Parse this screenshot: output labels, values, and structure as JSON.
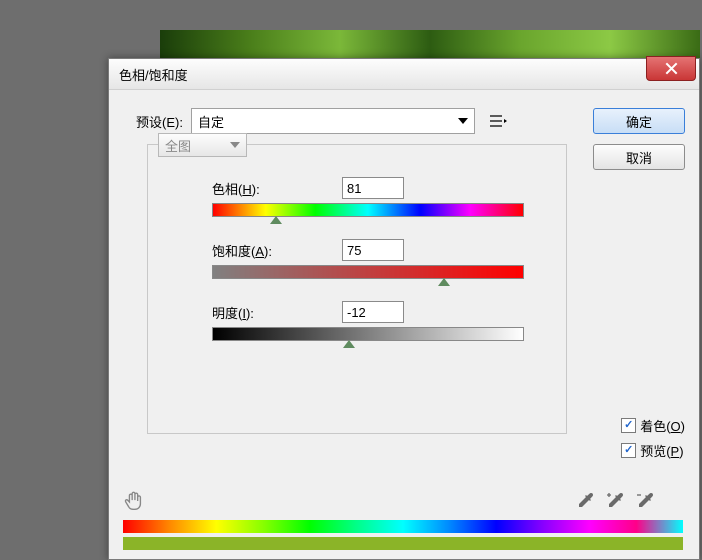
{
  "dialog": {
    "title": "色相/饱和度",
    "preset_label": "预设(E):",
    "preset_value": "自定",
    "range_value": "全图",
    "params": {
      "hue_label": "色相(",
      "hue_hotkey": "H",
      "hue_label_end": "):",
      "hue_value": "81",
      "sat_label": "饱和度(",
      "sat_hotkey": "A",
      "sat_label_end": "):",
      "sat_value": "75",
      "light_label": "明度(",
      "light_hotkey": "I",
      "light_label_end": "):",
      "light_value": "-12"
    },
    "colorize_label": "着色(",
    "colorize_hotkey": "O",
    "colorize_label_end": ")",
    "preview_label": "预览(",
    "preview_hotkey": "P",
    "preview_label_end": ")",
    "ok_label": "确定",
    "cancel_label": "取消"
  }
}
